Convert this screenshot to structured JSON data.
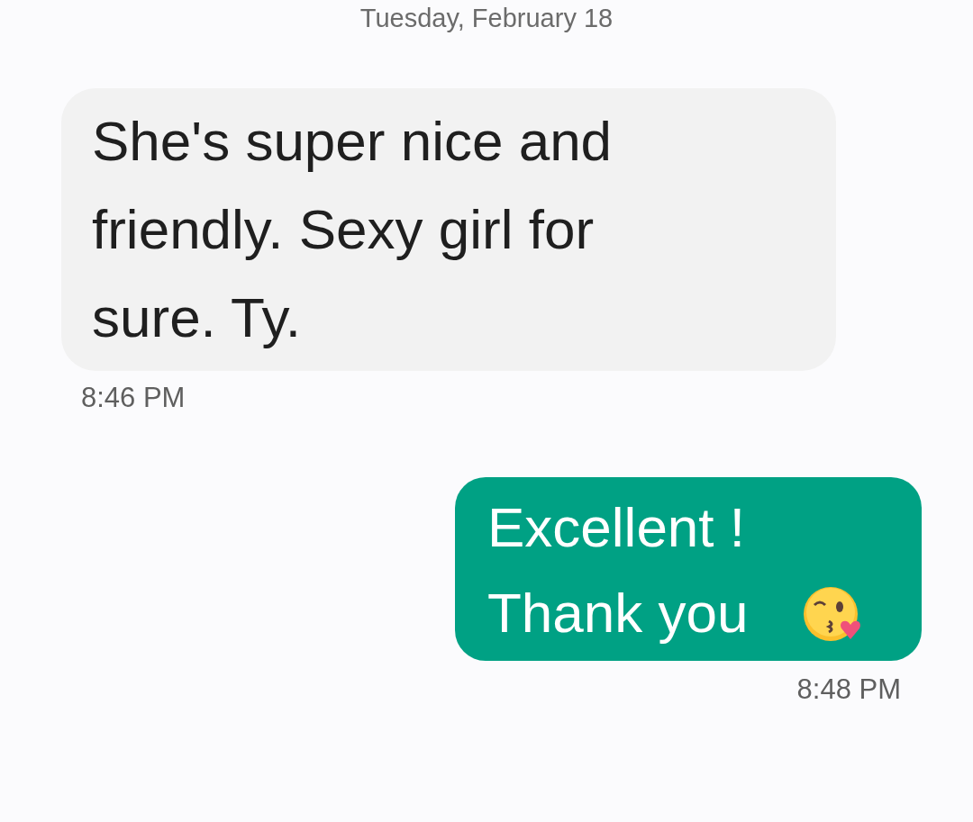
{
  "date_header": "Tuesday, February 18",
  "messages": [
    {
      "kind": "incoming",
      "text": "She's super nice and friendly. Sexy girl for sure. Ty.",
      "time": "8:46 PM"
    },
    {
      "kind": "outgoing",
      "text": "Excellent ! Thank you",
      "time": "8:48 PM"
    }
  ]
}
